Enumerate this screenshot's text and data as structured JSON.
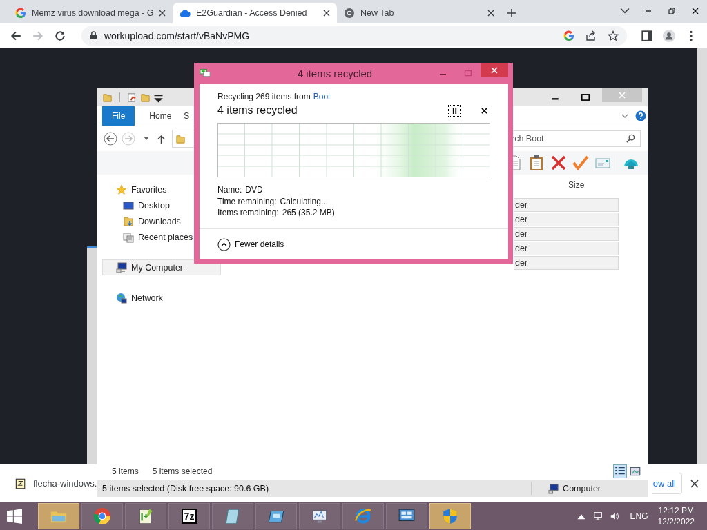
{
  "browser": {
    "tabs": [
      {
        "title": "Memz virus download mega - G",
        "kind": "google",
        "selected": false
      },
      {
        "title": "E2Guardian - Access Denied",
        "kind": "cloud",
        "selected": true
      },
      {
        "title": "New Tab",
        "kind": "chrome",
        "selected": false
      }
    ],
    "url": "workupload.com/start/vBaNvPMG"
  },
  "explorer": {
    "ribbon_tabs": [
      {
        "label": "File",
        "selected": true
      },
      {
        "label": "Home",
        "selected": false
      },
      {
        "label": "S",
        "selected": false
      }
    ],
    "search": {
      "placeholder": "rch Boot"
    },
    "column_header": "Size",
    "nav": [
      {
        "label": "Favorites",
        "kind": "star",
        "selected": false,
        "children": [
          {
            "label": "Desktop",
            "kind": "desktop",
            "selected": false
          },
          {
            "label": "Downloads",
            "kind": "downloads",
            "selected": false
          },
          {
            "label": "Recent places",
            "kind": "recent",
            "selected": false
          }
        ]
      },
      {
        "label": "My Computer",
        "kind": "computer",
        "selected": true
      },
      {
        "label": "Network",
        "kind": "network",
        "selected": false
      }
    ],
    "rows": [
      {
        "type": "der",
        "selected": true
      },
      {
        "type": "der",
        "selected": true
      },
      {
        "type": "der",
        "selected": true
      },
      {
        "type": "der",
        "selected": true
      },
      {
        "type": "der",
        "selected": true
      }
    ],
    "status": {
      "count": "5 items",
      "selection": "5 items selected"
    },
    "details_bar": {
      "text": "5 items selected (Disk free space: 90.6 GB)",
      "location": "Computer"
    }
  },
  "dialog": {
    "title": "4 items recycled",
    "source_prefix": "Recycling 269 items from",
    "source_link": "Boot",
    "heading": "4 items recycled",
    "details": [
      {
        "label": "Name:",
        "value": "DVD"
      },
      {
        "label": "Time remaining:",
        "value": "Calculating..."
      },
      {
        "label": "Items remaining:",
        "value": "265 (35.2 MB)"
      }
    ],
    "toggle": "Fewer details"
  },
  "download_bar": {
    "file": "flecha-windows.",
    "show_all": "ow all"
  },
  "taskbar": {
    "apps": [
      {
        "kind": "folder",
        "highlighted": true
      },
      {
        "kind": "chrome",
        "highlighted": false
      },
      {
        "kind": "notepad",
        "highlighted": false
      },
      {
        "kind": "archive",
        "label": "7z",
        "highlighted": false
      },
      {
        "kind": "notebook",
        "highlighted": false
      },
      {
        "kind": "window",
        "highlighted": false
      },
      {
        "kind": "monitor",
        "highlighted": false
      },
      {
        "kind": "browser",
        "highlighted": false
      },
      {
        "kind": "panel",
        "highlighted": false
      },
      {
        "kind": "shield",
        "highlighted": true
      }
    ],
    "language": "ENG",
    "time": "12:12 PM",
    "date": "12/2/2022"
  }
}
